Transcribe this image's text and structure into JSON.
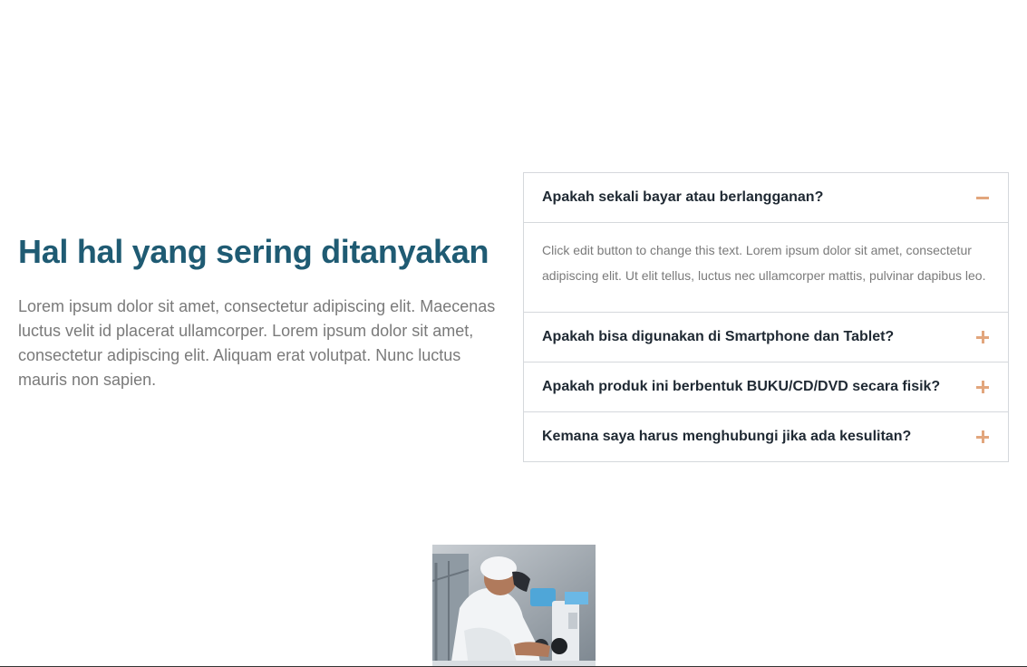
{
  "faq": {
    "title": "Hal hal yang sering ditanyakan",
    "intro": "Lorem ipsum dolor sit amet, consectetur adipiscing elit. Maecenas luctus velit id placerat ullamcorper. Lorem ipsum dolor sit amet, consectetur adipiscing elit. Aliquam erat volutpat. Nunc luctus mauris non sapien."
  },
  "accordion": {
    "accent_color": "#e2a67d",
    "items": [
      {
        "question": "Apakah sekali bayar atau berlangganan?",
        "answer": "Click edit button to change this text. Lorem ipsum dolor sit amet, consectetur adipiscing elit. Ut elit tellus, luctus nec ullamcorper mattis, pulvinar dapibus leo.",
        "expanded": true,
        "icon": "minus-icon"
      },
      {
        "question": "Apakah bisa digunakan di Smartphone dan Tablet?",
        "expanded": false,
        "icon": "plus-icon"
      },
      {
        "question": "Apakah produk ini berbentuk BUKU/CD/DVD secara fisik?",
        "expanded": false,
        "icon": "plus-icon"
      },
      {
        "question": "Kemana saya harus menghubungi jika ada kesulitan?",
        "expanded": false,
        "icon": "plus-icon"
      }
    ]
  },
  "image": {
    "subject": "scientist-microscope-photo"
  }
}
